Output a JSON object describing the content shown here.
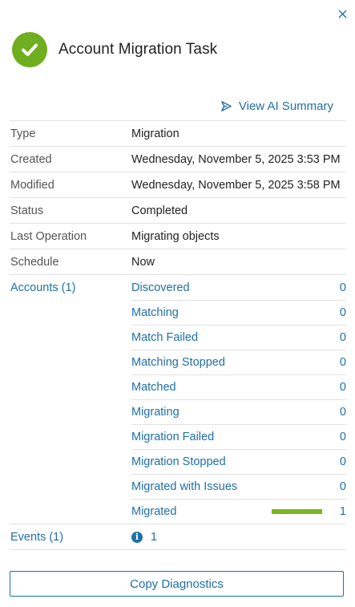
{
  "header": {
    "title": "Account Migration Task",
    "status_color": "#6fae1e",
    "status_icon": "checkmark-icon"
  },
  "ai_summary": {
    "label": "View AI Summary",
    "icon": "ai-summary-icon"
  },
  "details": [
    {
      "label": "Type",
      "value": "Migration"
    },
    {
      "label": "Created",
      "value": "Wednesday, November 5, 2025 3:53 PM"
    },
    {
      "label": "Modified",
      "value": "Wednesday, November 5, 2025 3:58 PM"
    },
    {
      "label": "Status",
      "value": "Completed"
    },
    {
      "label": "Last Operation",
      "value": "Migrating objects"
    },
    {
      "label": "Schedule",
      "value": "Now"
    }
  ],
  "accounts": {
    "label": "Accounts (1)",
    "states": [
      {
        "label": "Discovered",
        "count": "0"
      },
      {
        "label": "Matching",
        "count": "0"
      },
      {
        "label": "Match Failed",
        "count": "0"
      },
      {
        "label": "Matching Stopped",
        "count": "0"
      },
      {
        "label": "Matched",
        "count": "0"
      },
      {
        "label": "Migrating",
        "count": "0"
      },
      {
        "label": "Migration Failed",
        "count": "0"
      },
      {
        "label": "Migration Stopped",
        "count": "0"
      },
      {
        "label": "Migrated with Issues",
        "count": "0"
      },
      {
        "label": "Migrated",
        "count": "1",
        "progress_fraction": 1.0,
        "progress_color": "#7db51f"
      }
    ]
  },
  "events": {
    "label": "Events (1)",
    "count": "1",
    "icon": "info-icon"
  },
  "footer": {
    "copy_button_label": "Copy Diagnostics"
  },
  "colors": {
    "link": "#1f6fa8",
    "success": "#6fae1e"
  }
}
